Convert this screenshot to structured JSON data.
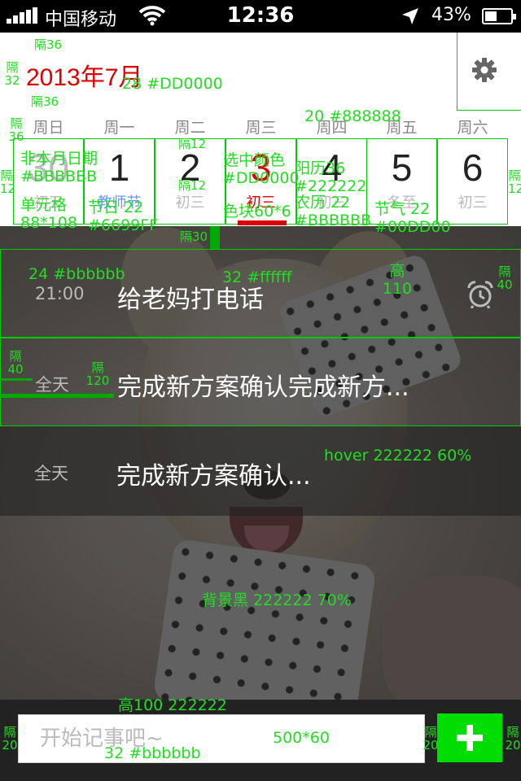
{
  "status_bar": {
    "carrier": "中国移动",
    "time": "12:36",
    "battery": "43%"
  },
  "header": {
    "month_title": "2013年7月"
  },
  "weekdays": [
    "周日",
    "周一",
    "周二",
    "周三",
    "周四",
    "周五",
    "周六"
  ],
  "days": [
    {
      "num": "30",
      "sub": "初三",
      "state": "other"
    },
    {
      "num": "1",
      "sub": "教师节",
      "state": "festival"
    },
    {
      "num": "2",
      "sub": "初三",
      "state": "normal"
    },
    {
      "num": "3",
      "sub": "初三",
      "state": "selected"
    },
    {
      "num": "4",
      "sub": "初三",
      "state": "normal"
    },
    {
      "num": "5",
      "sub": "冬至",
      "state": "normal"
    },
    {
      "num": "6",
      "sub": "初三",
      "state": "normal"
    }
  ],
  "events": [
    {
      "time": "21:00",
      "title": "给老妈打电话",
      "has_alarm": true
    },
    {
      "time": "全天",
      "title": "完成新方案确认完成新方..."
    },
    {
      "time": "全天",
      "title": "完成新方案确认..."
    }
  ],
  "bottom_bar": {
    "input_placeholder": "开始记事吧~"
  },
  "colors": {
    "accent_red": "#DD0000",
    "weekday_gray": "#888888",
    "other_month": "#BBBBBB",
    "festival_blue": "#6699FF",
    "add_green": "#00DD00",
    "overlay": "#222222"
  },
  "annotations": {
    "gap36_top": "隔36",
    "gap32": "隔 32",
    "title_spec": "28 #DD0000",
    "gap36_b": "隔36",
    "gap36_left": "隔 36",
    "weekday_spec": "20 #888888",
    "other_month_spec": "非本月日期 #BBBBBB",
    "cell_spec": "单元格 88*108",
    "festival_spec": "节日 22 #6699FF",
    "gap12_top": "隔12",
    "gap12_mid": "隔12",
    "selected_spec": "选中颜色 #DD0000",
    "block_spec": "色块60*6",
    "solar_spec": "阳历36 #222222",
    "lunar_spec": "农历 22 #BBBBBB",
    "solar_term_spec": "节气 22 #00DD00",
    "gap12_left": "隔 12",
    "gap12_right": "隔 12",
    "gap30": "隔30",
    "time_spec": "24 #bbbbbb",
    "title_font_spec": "32 #ffffff",
    "row_height": "高 110",
    "gap40_right": "隔 40",
    "gap40_left": "隔 40",
    "gap120": "隔 120",
    "hover_spec": "hover  222222  60%",
    "bg_spec": "背景黑  222222  70%",
    "bar_height": "高100  222222",
    "input_size": "500*60",
    "input_font": "32 #bbbbbb",
    "gap20_left": "隔 20",
    "gap20_mid": "隔 20",
    "gap20_right": "隔 20"
  }
}
